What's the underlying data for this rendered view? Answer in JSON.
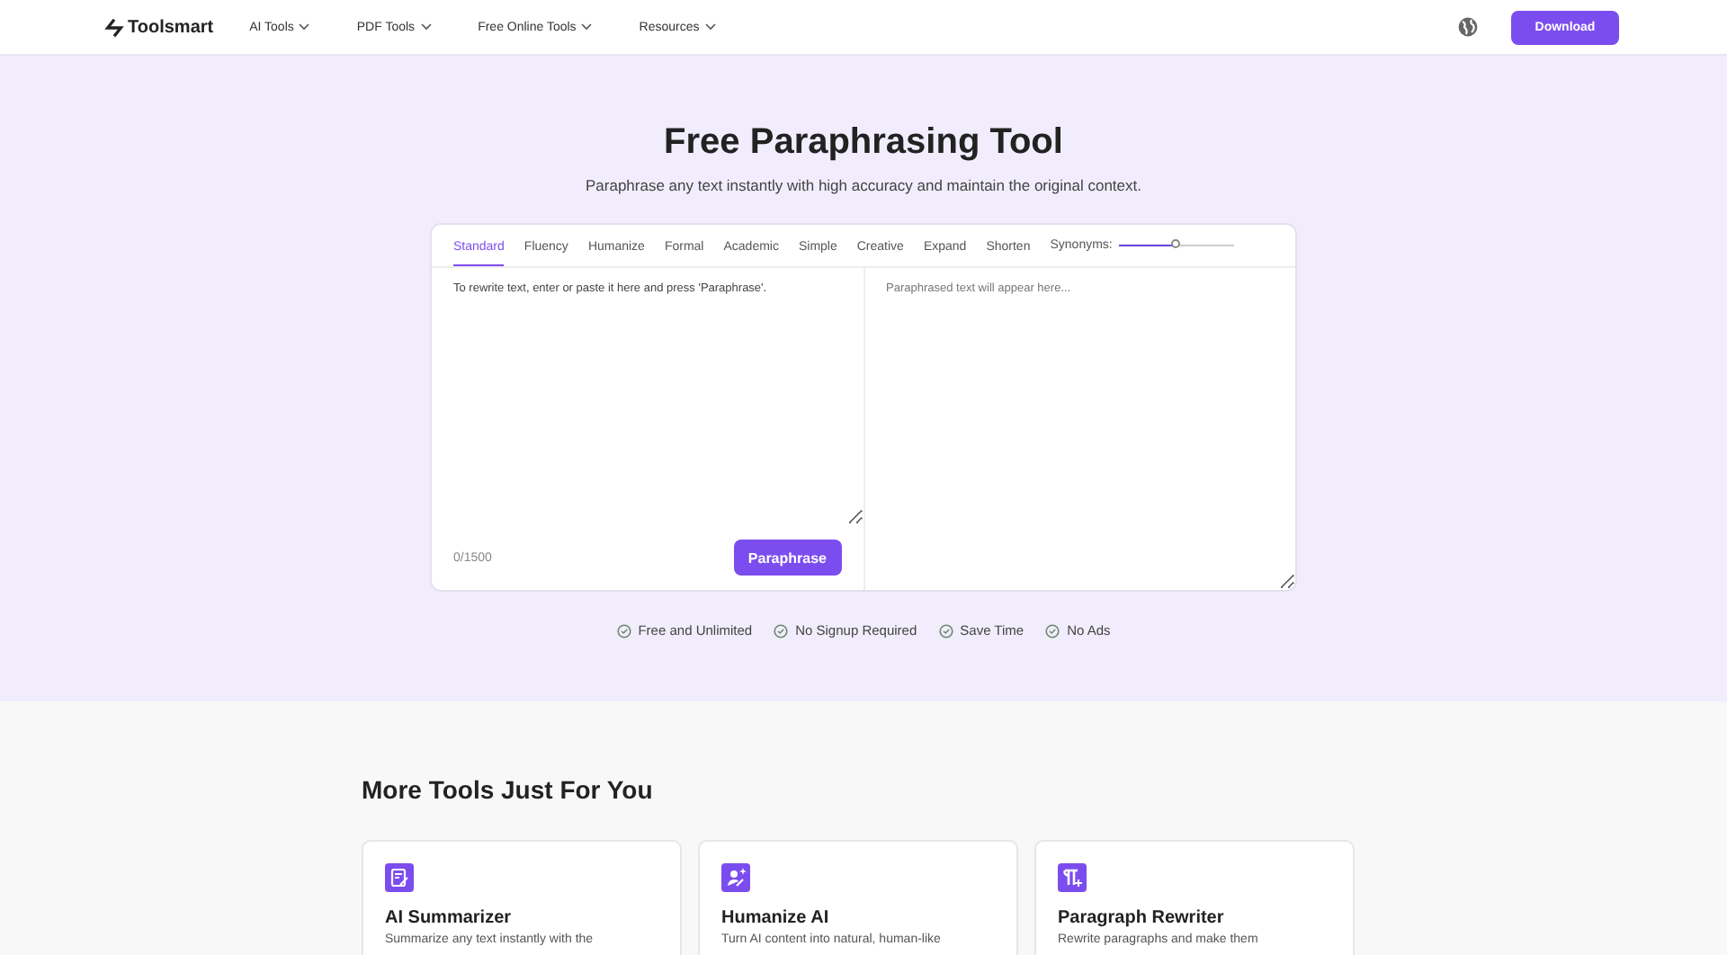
{
  "nav": {
    "logo": "Toolsmart",
    "menus": [
      "AI Tools",
      "PDF Tools",
      "Free Online Tools",
      "Resources"
    ],
    "download": "Download"
  },
  "hero": {
    "title": "Free Paraphrasing Tool",
    "subtitle": "Paraphrase any text instantly with high accuracy and maintain the original context."
  },
  "modes": [
    {
      "label": "Standard",
      "selected": true
    },
    {
      "label": "Fluency",
      "selected": false
    },
    {
      "label": "Humanize",
      "selected": false
    },
    {
      "label": "Formal",
      "selected": false
    },
    {
      "label": "Academic",
      "selected": false
    },
    {
      "label": "Simple",
      "selected": false
    },
    {
      "label": "Creative",
      "selected": false
    },
    {
      "label": "Expand",
      "selected": false
    },
    {
      "label": "Shorten",
      "selected": false
    }
  ],
  "synonyms": {
    "label": "Synonyms:",
    "level": 0.5
  },
  "input": {
    "placeholder": "To rewrite text, enter or paste it here and press 'Paraphrase'.",
    "count": "0/1500",
    "button": "Paraphrase"
  },
  "output": {
    "placeholder": "Paraphrased text will appear here..."
  },
  "features": [
    "Free and Unlimited",
    "No Signup Required",
    "Save Time",
    "No Ads"
  ],
  "more": {
    "title": "More Tools Just For You",
    "cards": [
      {
        "kind": "summarizer",
        "title": "AI Summarizer",
        "text": "Summarize any text instantly with the"
      },
      {
        "kind": "humanize",
        "title": "Humanize AI",
        "text": "Turn AI content into natural, human-like"
      },
      {
        "kind": "rewriter",
        "title": "Paragraph Rewriter",
        "text": "Rewrite paragraphs and make them"
      }
    ]
  }
}
